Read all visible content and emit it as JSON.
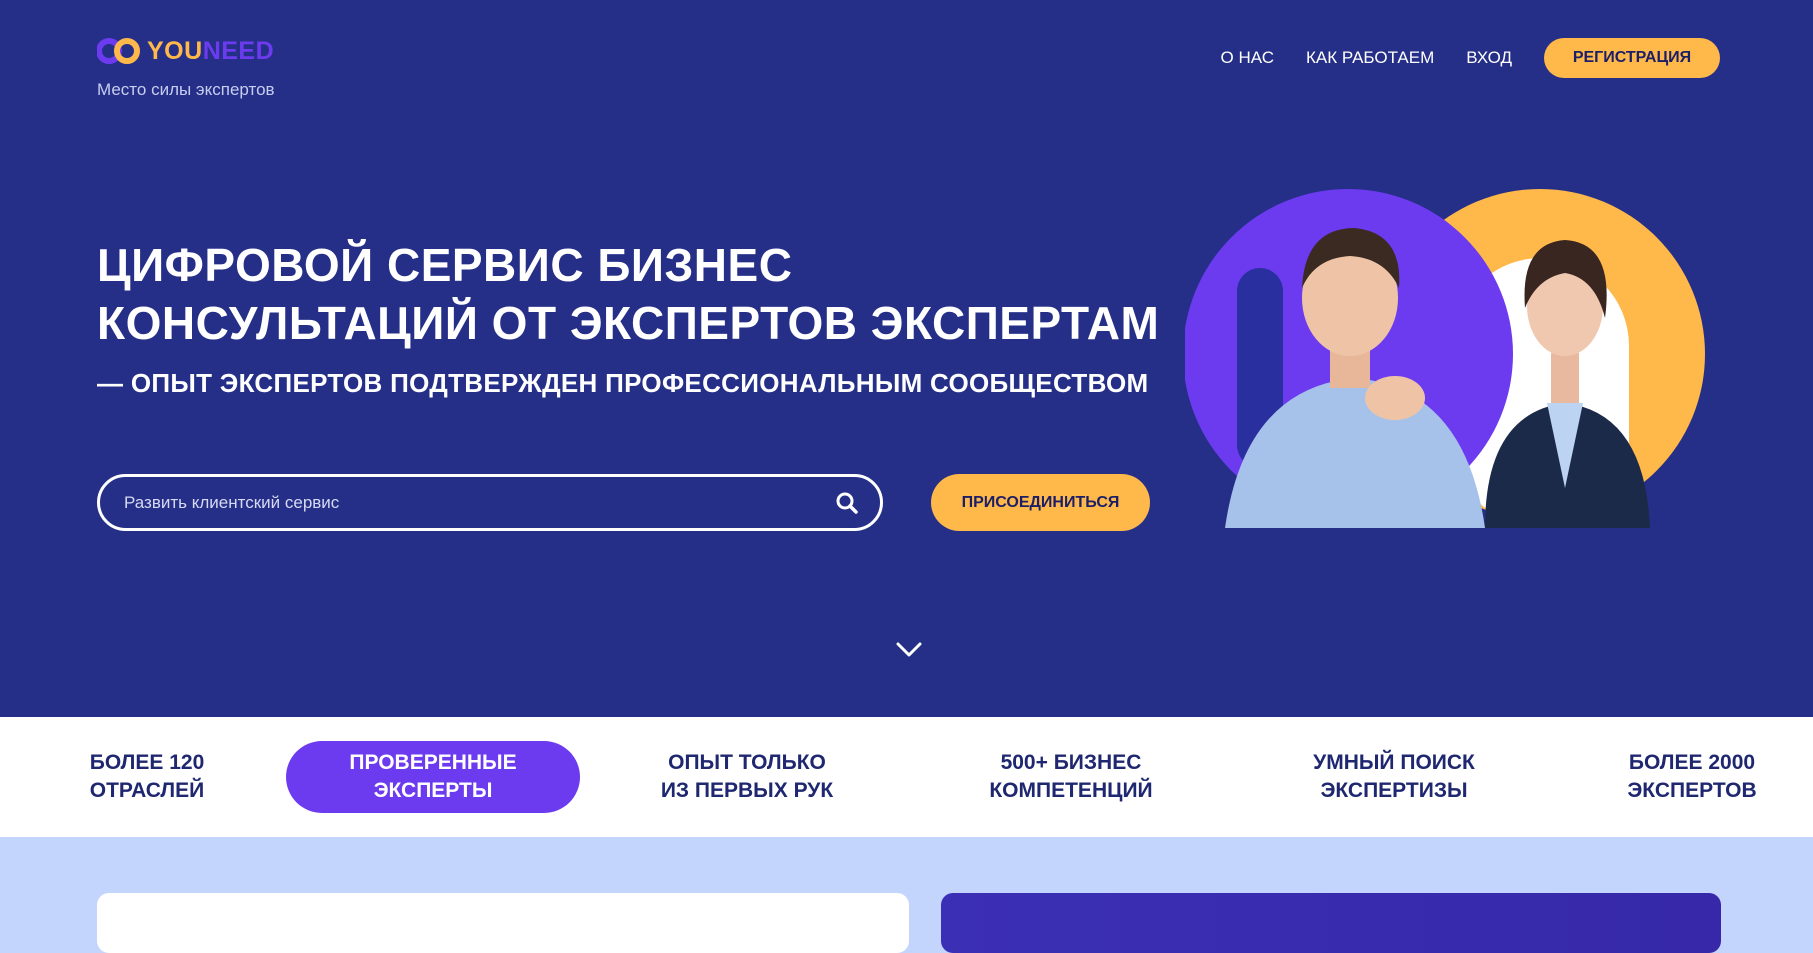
{
  "brand": {
    "logo_you": "YOU",
    "logo_need": "NEED",
    "tagline": "Место силы экспертов",
    "colors": {
      "navy": "#252f87",
      "yellow": "#ffb84a",
      "purple": "#6c3bf0",
      "light_blue": "#c3d4fd"
    }
  },
  "nav": {
    "about": "О НАС",
    "how_we_work": "КАК РАБОТАЕМ",
    "login": "ВХОД",
    "register": "РЕГИСТРАЦИЯ"
  },
  "hero": {
    "headline_line1": "ЦИФРОВОЙ СЕРВИС БИЗНЕС",
    "headline_line2": "КОНСУЛЬТАЦИЙ ОТ ЭКСПЕРТОВ ЭКСПЕРТАМ",
    "subheadline": "— ОПЫТ ЭКСПЕРТОВ ПОДТВЕРЖДЕН ПРОФЕССИОНАЛЬНЫМ СООБЩЕСТВОМ",
    "search_placeholder": "Развить клиентский сервис",
    "search_icon": "search-icon",
    "join_button": "ПРИСОЕДИНИТЬСЯ",
    "scroll_icon": "chevron-down-icon"
  },
  "features": [
    {
      "line1": "БОЛЕЕ 120",
      "line2": "ОТРАСЛЕЙ",
      "active": false
    },
    {
      "line1": "ПРОВЕРЕННЫЕ",
      "line2": "ЭКСПЕРТЫ",
      "active": true
    },
    {
      "line1": "ОПЫТ ТОЛЬКО",
      "line2": "ИЗ ПЕРВЫХ РУК",
      "active": false
    },
    {
      "line1": "500+ БИЗНЕС",
      "line2": "КОМПЕТЕНЦИЙ",
      "active": false
    },
    {
      "line1": "УМНЫЙ ПОИСК",
      "line2": "ЭКСПЕРТИЗЫ",
      "active": false
    },
    {
      "line1": "БОЛЕЕ 2000",
      "line2": "ЭКСПЕРТОВ",
      "active": false
    }
  ]
}
